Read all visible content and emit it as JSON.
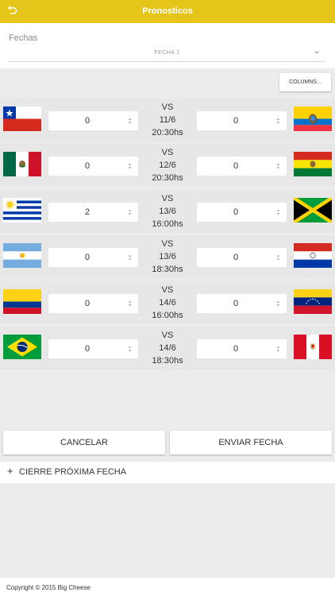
{
  "header": {
    "title": "Pronosticos",
    "back_icon": "back-arrow-icon"
  },
  "fechas": {
    "label": "Fechas",
    "selected": "FECHA 1"
  },
  "columns_button": "COLUMNS...",
  "matches": [
    {
      "home_team": "Chile",
      "home_score": "0",
      "vs": "VS",
      "date": "11/6",
      "time": "20:30hs",
      "away_score": "0",
      "away_team": "Ecuador"
    },
    {
      "home_team": "México",
      "home_score": "0",
      "vs": "VS",
      "date": "12/6",
      "time": "20:30hs",
      "away_score": "0",
      "away_team": "Bolivia"
    },
    {
      "home_team": "Uruguay",
      "home_score": "2",
      "vs": "VS",
      "date": "13/6",
      "time": "16:00hs",
      "away_score": "0",
      "away_team": "Jamaica"
    },
    {
      "home_team": "Argentina",
      "home_score": "0",
      "vs": "VS",
      "date": "13/6",
      "time": "18:30hs",
      "away_score": "0",
      "away_team": "Paraguay"
    },
    {
      "home_team": "Colombia",
      "home_score": "0",
      "vs": "VS",
      "date": "14/6",
      "time": "16:00hs",
      "away_score": "0",
      "away_team": "Venezuela"
    },
    {
      "home_team": "Brasil",
      "home_score": "0",
      "vs": "VS",
      "date": "14/6",
      "time": "18:30hs",
      "away_score": "0",
      "away_team": "Perú"
    }
  ],
  "actions": {
    "cancel": "CANCELAR",
    "send": "ENVIAR FECHA"
  },
  "cierre": {
    "icon": "+",
    "label": "CIERRE PRÓXIMA FECHA"
  },
  "footer": {
    "copyright": "Copyright © 2015 Big Cheese"
  },
  "colors": {
    "accent": "#e6c51b",
    "background": "#ececec",
    "row": "#e7e7e7"
  }
}
